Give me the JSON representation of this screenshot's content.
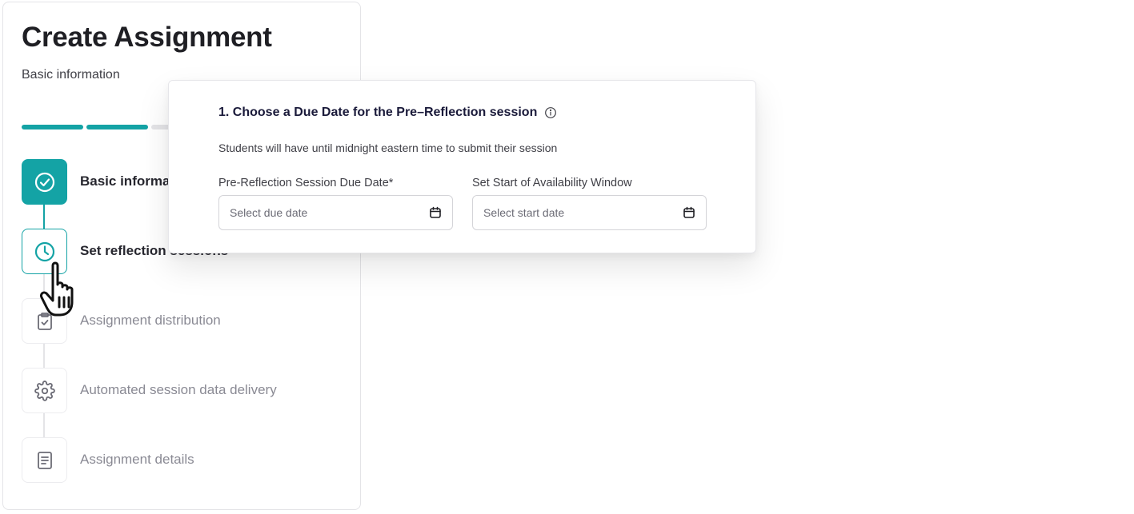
{
  "page": {
    "title": "Create Assignment",
    "subtitle": "Basic information"
  },
  "progress": {
    "completed_fraction": 0.4,
    "segments": [
      "complete",
      "complete",
      "pending",
      "pending",
      "pending"
    ]
  },
  "steps": [
    {
      "label": "Basic information",
      "status": "complete",
      "icon": "check-circle-icon"
    },
    {
      "label": "Set reflection sessions",
      "status": "active",
      "icon": "clock-icon"
    },
    {
      "label": "Assignment distribution",
      "status": "pending",
      "icon": "clipboard-check-icon"
    },
    {
      "label": "Automated session data delivery",
      "status": "pending",
      "icon": "gear-icon"
    },
    {
      "label": "Assignment details",
      "status": "pending",
      "icon": "document-icon"
    }
  ],
  "popover": {
    "title": "1. Choose a Due Date for the Pre–Reflection session",
    "description": "Students will have until midnight eastern time to submit their session",
    "due_date": {
      "label": "Pre-Reflection Session Due Date*",
      "placeholder": "Select due date",
      "icon": "calendar-icon"
    },
    "start_date": {
      "label": "Set Start of Availability Window",
      "placeholder": "Select start date",
      "icon": "calendar-icon"
    }
  },
  "colors": {
    "accent": "#14a3a5",
    "muted_text": "#8a8a94",
    "title_text": "#1f1f24",
    "popover_title": "#1a1a3a"
  }
}
